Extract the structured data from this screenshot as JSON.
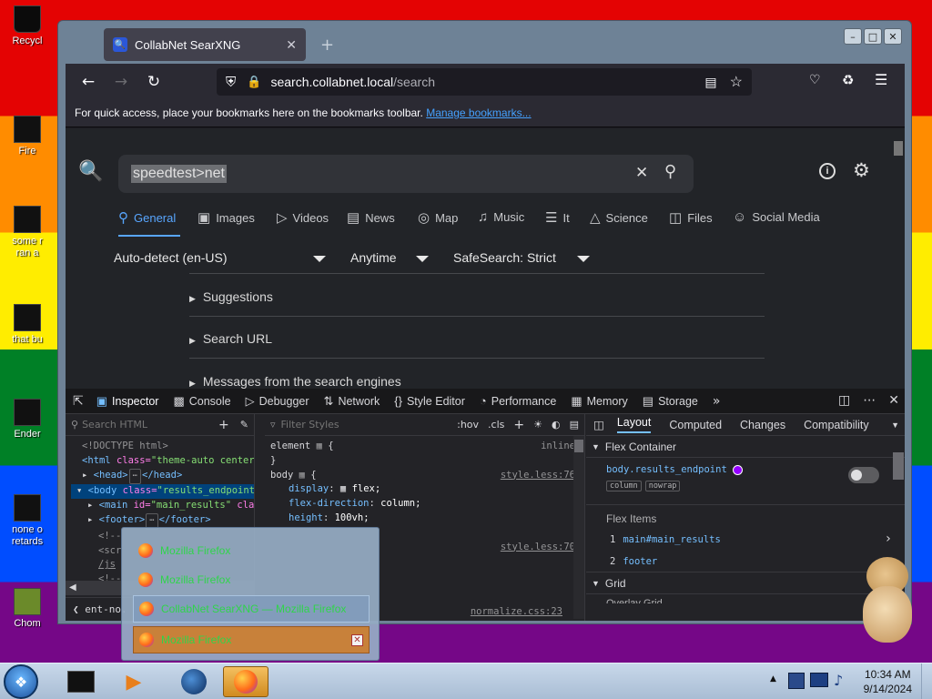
{
  "desktop": {
    "icons": [
      {
        "label": "Recycl"
      },
      {
        "label": "Fire"
      },
      {
        "label": "some r\nran a"
      },
      {
        "label": "that bu"
      },
      {
        "label": "Ender"
      },
      {
        "label": "none o\nretards"
      },
      {
        "label": "Chom"
      }
    ]
  },
  "browser": {
    "tab_title": "CollabNet SearXNG",
    "url_host": "search.collabnet.local",
    "url_path": "/search",
    "bookmarks_msg": "For quick access, place your bookmarks here on the bookmarks toolbar.",
    "bookmarks_link": "Manage bookmarks..."
  },
  "search": {
    "query": "speedtest>net",
    "categories": [
      {
        "label": "General",
        "icon": "search-icon"
      },
      {
        "label": "Images",
        "icon": "image-icon"
      },
      {
        "label": "Videos",
        "icon": "play-icon"
      },
      {
        "label": "News",
        "icon": "news-icon"
      },
      {
        "label": "Map",
        "icon": "map-pin-icon"
      },
      {
        "label": "Music",
        "icon": "music-icon"
      },
      {
        "label": "It",
        "icon": "stack-icon"
      },
      {
        "label": "Science",
        "icon": "science-icon"
      },
      {
        "label": "Files",
        "icon": "files-icon"
      },
      {
        "label": "Social Media",
        "icon": "people-icon"
      }
    ],
    "language": "Auto-detect (en-US)",
    "time": "Anytime",
    "safesearch": "SafeSearch: Strict",
    "accordions": [
      "Suggestions",
      "Search URL",
      "Messages from the search engines"
    ]
  },
  "devtools": {
    "tabs": [
      "Inspector",
      "Console",
      "Debugger",
      "Network",
      "Style Editor",
      "Performance",
      "Memory",
      "Storage"
    ],
    "search_html_placeholder": "Search HTML",
    "filter_styles_placeholder": "Filter Styles",
    "hov": ":hov",
    "cls": ".cls",
    "html_lines": {
      "doctype": "<!DOCTYPE html>",
      "html_open": "<html",
      "html_attr": "class=",
      "html_val": "\"theme-auto center-",
      "head": "<head>",
      "head_close": "</head>",
      "body_open": "<body",
      "body_attr": "class=",
      "body_val": "\"results_endpoint\"",
      "main_open": "<main",
      "main_attr": "id=",
      "main_val": "\"main_results\"",
      "main_tail": " clas",
      "footer": "<footer>",
      "footer_close": "</footer>",
      "c1": "<!--",
      "c2": "<scr",
      "c3": "/js",
      "c4": "<!--",
      "breadcrumb": "ent-no."
    },
    "rules": {
      "element_sel": "element",
      "element_src": "inline",
      "body_sel": "body",
      "body_src": "style.less:76",
      "decls": [
        {
          "prop": "display",
          "val": "flex;"
        },
        {
          "prop": "flex-direction",
          "val": "column;"
        },
        {
          "prop": "height",
          "val": "100vh;"
        }
      ],
      "src2": "style.less:70",
      "src3": "normalize.css:23"
    },
    "layout_tabs": [
      "Layout",
      "Computed",
      "Changes",
      "Compatibility"
    ],
    "flex_container_label": "Flex Container",
    "flex_el_tag": "body",
    "flex_el_class": ".results_endpoint",
    "chips": [
      "column",
      "nowrap"
    ],
    "flex_items_label": "Flex Items",
    "flex_items": [
      {
        "n": "1",
        "tag": "main",
        "rest": "#main_results"
      },
      {
        "n": "2",
        "tag": "footer",
        "rest": ""
      }
    ],
    "grid_label": "Grid",
    "overlay_label": "Overlay Grid"
  },
  "jumplist": {
    "items": [
      {
        "label": "Mozilla Firefox"
      },
      {
        "label": "Mozilla Firefox"
      },
      {
        "label": "CollabNet SearXNG — Mozilla Firefox"
      },
      {
        "label": "Mozilla Firefox"
      }
    ]
  },
  "taskbar": {
    "time": "10:34 AM",
    "date": "9/14/2024"
  }
}
